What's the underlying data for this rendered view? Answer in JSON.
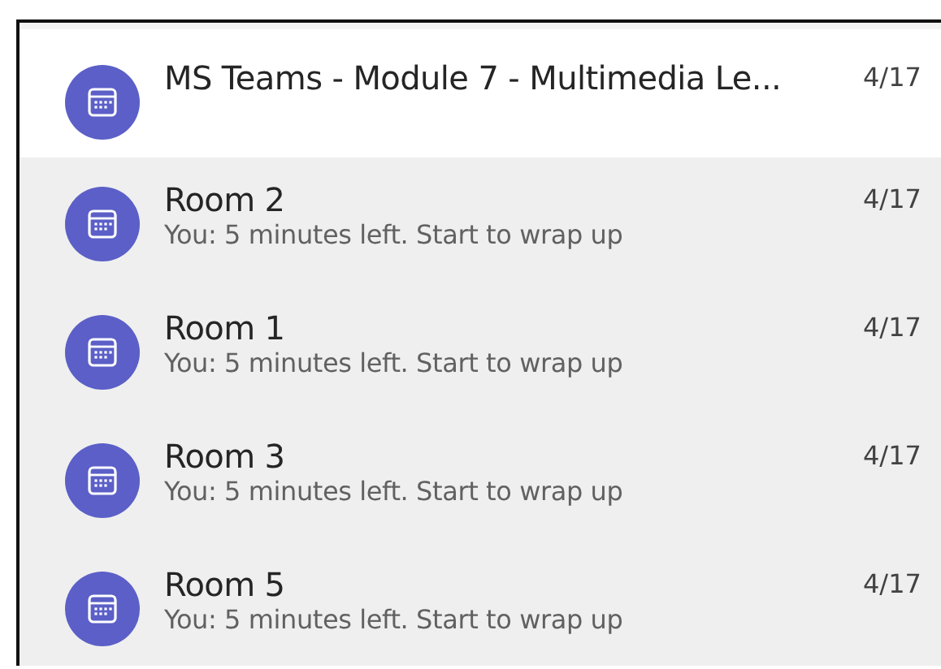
{
  "items": [
    {
      "title": "MS Teams - Module 7 - Multimedia Le...",
      "date": "4/17",
      "selected": true
    },
    {
      "title": "Room 2",
      "preview": "You: 5 minutes left. Start to wrap up",
      "date": "4/17",
      "selected": false
    },
    {
      "title": "Room 1",
      "preview": "You: 5 minutes left. Start to wrap up",
      "date": "4/17",
      "selected": false
    },
    {
      "title": "Room 3",
      "preview": "You: 5 minutes left. Start to wrap up",
      "date": "4/17",
      "selected": false
    },
    {
      "title": "Room 5",
      "preview": "You: 5 minutes left. Start to wrap up",
      "date": "4/17",
      "selected": false
    }
  ]
}
